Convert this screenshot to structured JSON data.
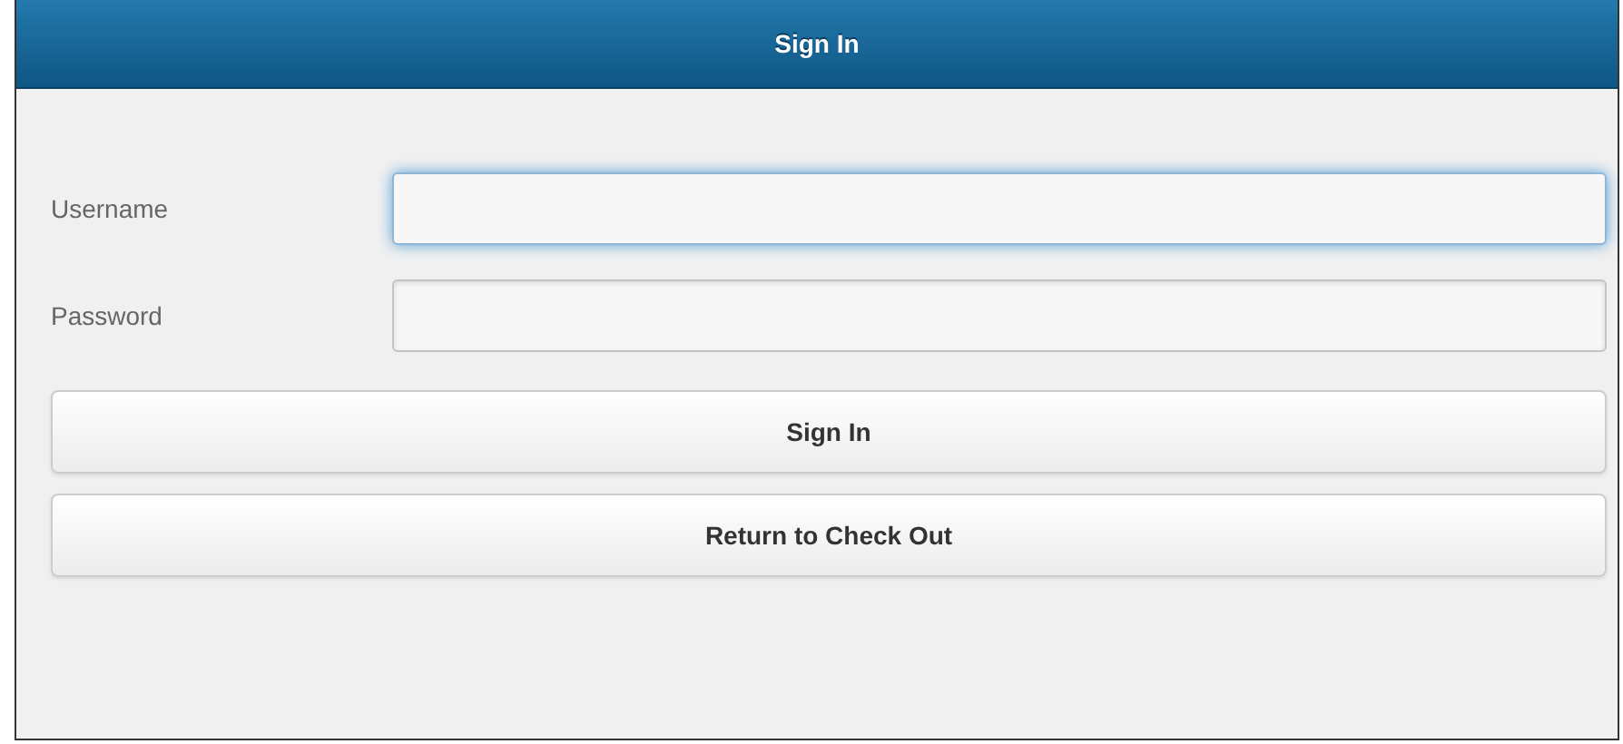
{
  "header": {
    "title": "Sign In"
  },
  "fields": [
    {
      "label": "Username",
      "focused": true
    },
    {
      "label": "Password",
      "focused": false
    }
  ],
  "buttons": [
    "Sign In",
    "Return to Check Out"
  ]
}
